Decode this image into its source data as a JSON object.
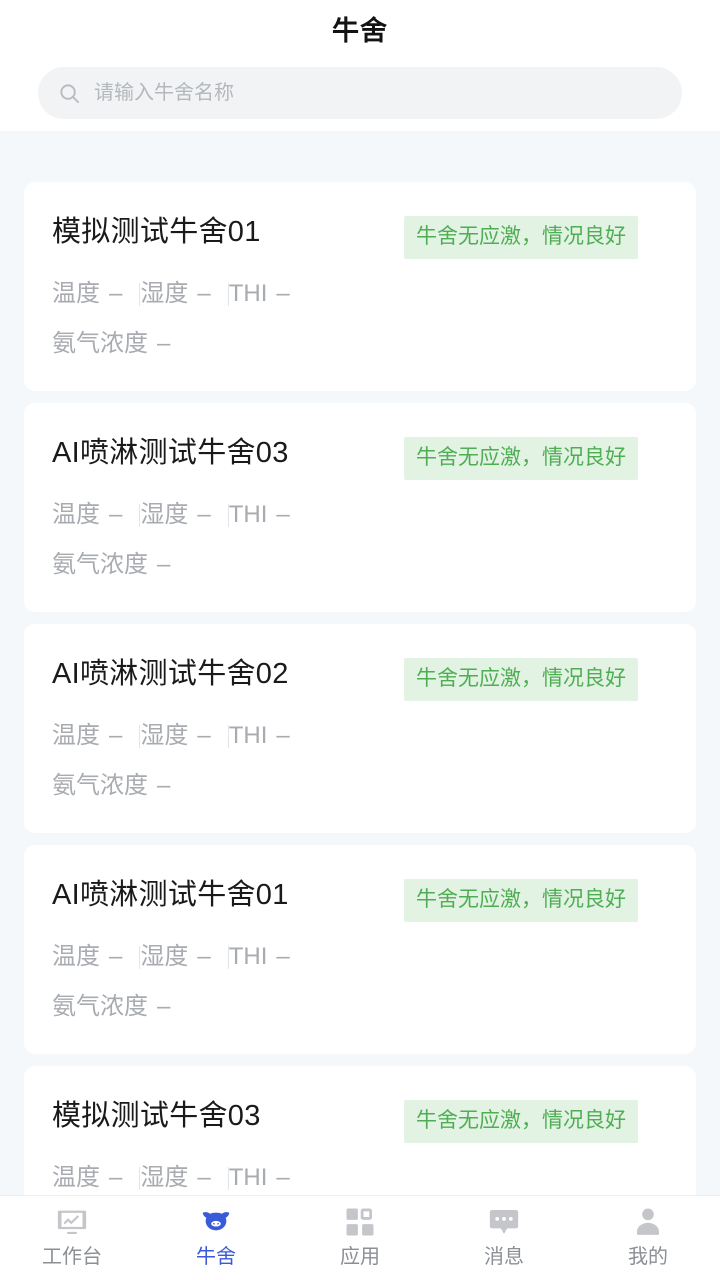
{
  "header": {
    "title": "牛舍"
  },
  "search": {
    "placeholder": "请输入牛舍名称",
    "value": "",
    "icon": "search-icon"
  },
  "colors": {
    "page_background": "#f5f8fb",
    "card_background": "#ffffff",
    "badge_background": "#e2f3e3",
    "badge_text": "#4fae54",
    "accent": "#3a5bd9",
    "muted_text": "#a8abb0",
    "title_text": "#1a1a1a"
  },
  "labels": {
    "temperature": "温度",
    "humidity": "湿度",
    "thi": "THI",
    "ammonia": "氨气浓度"
  },
  "cards": [
    {
      "name": "模拟测试牛舍01",
      "status": "牛舍无应激，情况良好",
      "temperature": "–",
      "humidity": "–",
      "thi": "–",
      "ammonia": "–"
    },
    {
      "name": "AI喷淋测试牛舍03",
      "status": "牛舍无应激，情况良好",
      "temperature": "–",
      "humidity": "–",
      "thi": "–",
      "ammonia": "–"
    },
    {
      "name": "AI喷淋测试牛舍02",
      "status": "牛舍无应激，情况良好",
      "temperature": "–",
      "humidity": "–",
      "thi": "–",
      "ammonia": "–"
    },
    {
      "name": "AI喷淋测试牛舍01",
      "status": "牛舍无应激，情况良好",
      "temperature": "–",
      "humidity": "–",
      "thi": "–",
      "ammonia": "–"
    },
    {
      "name": "模拟测试牛舍03",
      "status": "牛舍无应激，情况良好",
      "temperature": "–",
      "humidity": "–",
      "thi": "–",
      "ammonia": "–"
    }
  ],
  "tabbar": {
    "active_index": 1,
    "items": [
      {
        "label": "工作台",
        "icon": "dashboard-chart-icon"
      },
      {
        "label": "牛舍",
        "icon": "cow-head-icon"
      },
      {
        "label": "应用",
        "icon": "grid-apps-icon"
      },
      {
        "label": "消息",
        "icon": "chat-bubble-icon"
      },
      {
        "label": "我的",
        "icon": "person-icon"
      }
    ]
  }
}
